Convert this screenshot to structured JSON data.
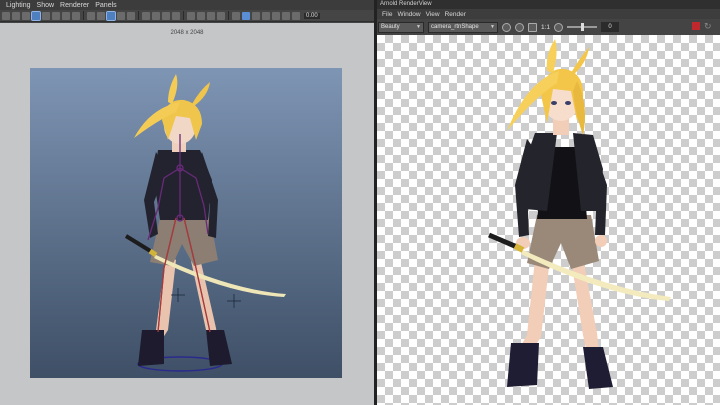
{
  "maya": {
    "menu": [
      "Lighting",
      "Show",
      "Renderer",
      "Panels"
    ],
    "toolbar_value": "0.00",
    "resolution_label": "2048 x 2048"
  },
  "renderview": {
    "title": "Arnold RenderView",
    "menu": [
      "File",
      "Window",
      "View",
      "Render"
    ],
    "aov_select": "Beauty",
    "camera_select": "camera_rtnShape",
    "ratio": "1:1",
    "exposure": "0",
    "colors": {
      "stop": "#c0282d"
    }
  },
  "icons": [
    "select-icon",
    "move-icon",
    "wireframe-icon",
    "smooth-shade-icon",
    "lighting-icon",
    "camera-icon",
    "stop-icon",
    "refresh-icon"
  ]
}
